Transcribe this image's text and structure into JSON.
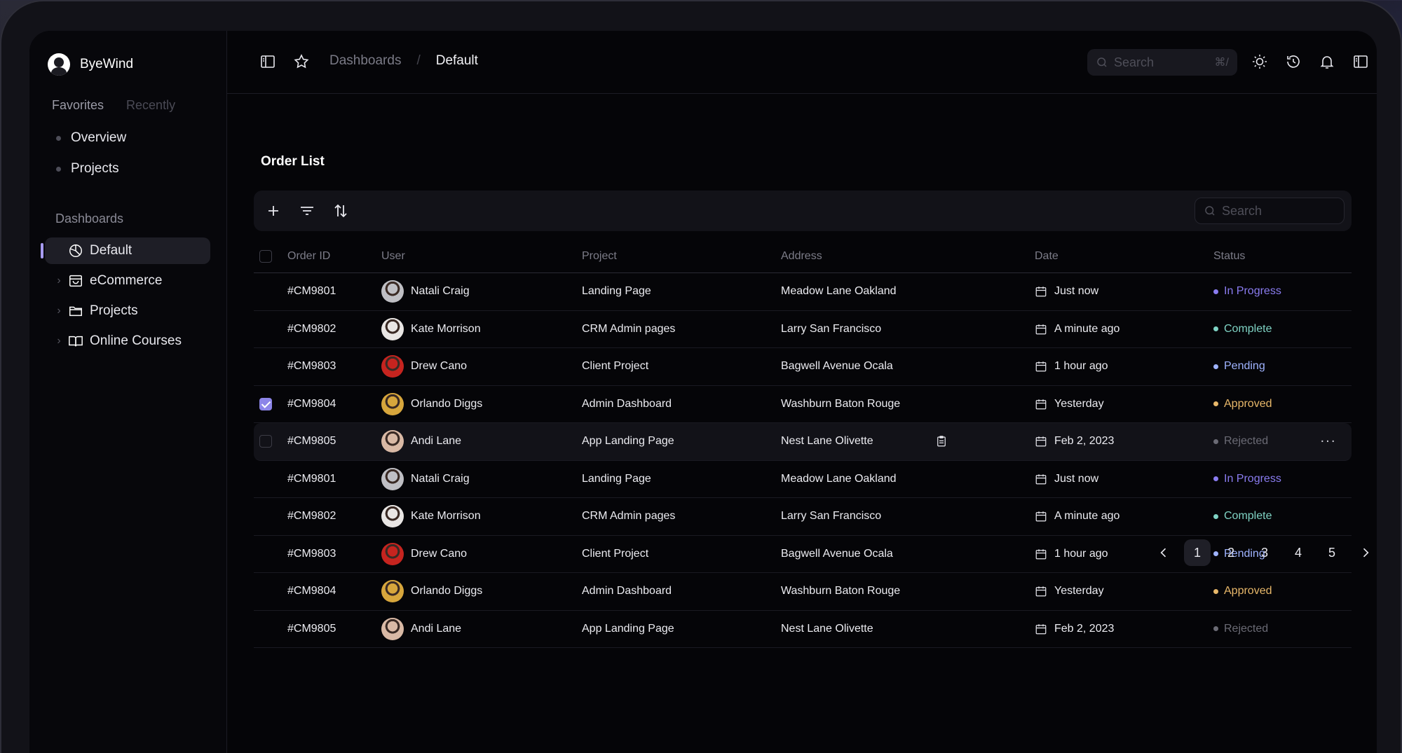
{
  "brand": {
    "name": "ByeWind"
  },
  "sidebar": {
    "tabs": [
      "Favorites",
      "Recently"
    ],
    "favorites": [
      "Overview",
      "Projects"
    ],
    "section_title": "Dashboards",
    "nav": [
      {
        "label": "Default",
        "icon": "pie-chart-icon",
        "active": true
      },
      {
        "label": "eCommerce",
        "icon": "shopping-bag-icon"
      },
      {
        "label": "Projects",
        "icon": "folder-icon"
      },
      {
        "label": "Online Courses",
        "icon": "book-open-icon"
      }
    ]
  },
  "header": {
    "breadcrumb": [
      "Dashboards",
      "/",
      "Default"
    ],
    "search_placeholder": "Search",
    "search_shortcut": "⌘/"
  },
  "page": {
    "title": "Order List",
    "search_placeholder": "Search"
  },
  "table": {
    "columns": [
      "Order ID",
      "User",
      "Project",
      "Address",
      "Date",
      "Status"
    ],
    "rows": [
      {
        "id": "#CM9801",
        "user": "Natali Craig",
        "project": "Landing Page",
        "address": "Meadow Lane Oakland",
        "date": "Just now",
        "status": "In Progress",
        "status_color": "#8a7cf0",
        "avatar_color": "#bfbfc4"
      },
      {
        "id": "#CM9802",
        "user": "Kate Morrison",
        "project": "CRM Admin pages",
        "address": "Larry San Francisco",
        "date": "A minute ago",
        "status": "Complete",
        "status_color": "#7fd3c4",
        "avatar_color": "#e9e6e4"
      },
      {
        "id": "#CM9803",
        "user": "Drew Cano",
        "project": "Client Project",
        "address": "Bagwell Avenue Ocala",
        "date": "1 hour ago",
        "status": "Pending",
        "status_color": "#9fb3ff",
        "avatar_color": "#c6241f"
      },
      {
        "id": "#CM9804",
        "user": "Orlando Diggs",
        "project": "Admin Dashboard",
        "address": "Washburn Baton Rouge",
        "date": "Yesterday",
        "status": "Approved",
        "status_color": "#e8b86a",
        "avatar_color": "#d7a63c",
        "checked": true
      },
      {
        "id": "#CM9805",
        "user": "Andi Lane",
        "project": "App Landing Page",
        "address": "Nest Lane Olivette",
        "date": "Feb 2, 2023",
        "status": "Rejected",
        "status_color": "#6b6b75",
        "avatar_color": "#d9b9a5",
        "hover": true
      },
      {
        "id": "#CM9801",
        "user": "Natali Craig",
        "project": "Landing Page",
        "address": "Meadow Lane Oakland",
        "date": "Just now",
        "status": "In Progress",
        "status_color": "#8a7cf0",
        "avatar_color": "#bfbfc4"
      },
      {
        "id": "#CM9802",
        "user": "Kate Morrison",
        "project": "CRM Admin pages",
        "address": "Larry San Francisco",
        "date": "A minute ago",
        "status": "Complete",
        "status_color": "#7fd3c4",
        "avatar_color": "#e9e6e4"
      },
      {
        "id": "#CM9803",
        "user": "Drew Cano",
        "project": "Client Project",
        "address": "Bagwell Avenue Ocala",
        "date": "1 hour ago",
        "status": "Pending",
        "status_color": "#9fb3ff",
        "avatar_color": "#c6241f"
      },
      {
        "id": "#CM9804",
        "user": "Orlando Diggs",
        "project": "Admin Dashboard",
        "address": "Washburn Baton Rouge",
        "date": "Yesterday",
        "status": "Approved",
        "status_color": "#e8b86a",
        "avatar_color": "#d7a63c"
      },
      {
        "id": "#CM9805",
        "user": "Andi Lane",
        "project": "App Landing Page",
        "address": "Nest Lane Olivette",
        "date": "Feb 2, 2023",
        "status": "Rejected",
        "status_color": "#6b6b75",
        "avatar_color": "#d9b9a5"
      }
    ]
  },
  "pagination": {
    "pages": [
      "1",
      "2",
      "3",
      "4",
      "5"
    ],
    "current": "1"
  }
}
